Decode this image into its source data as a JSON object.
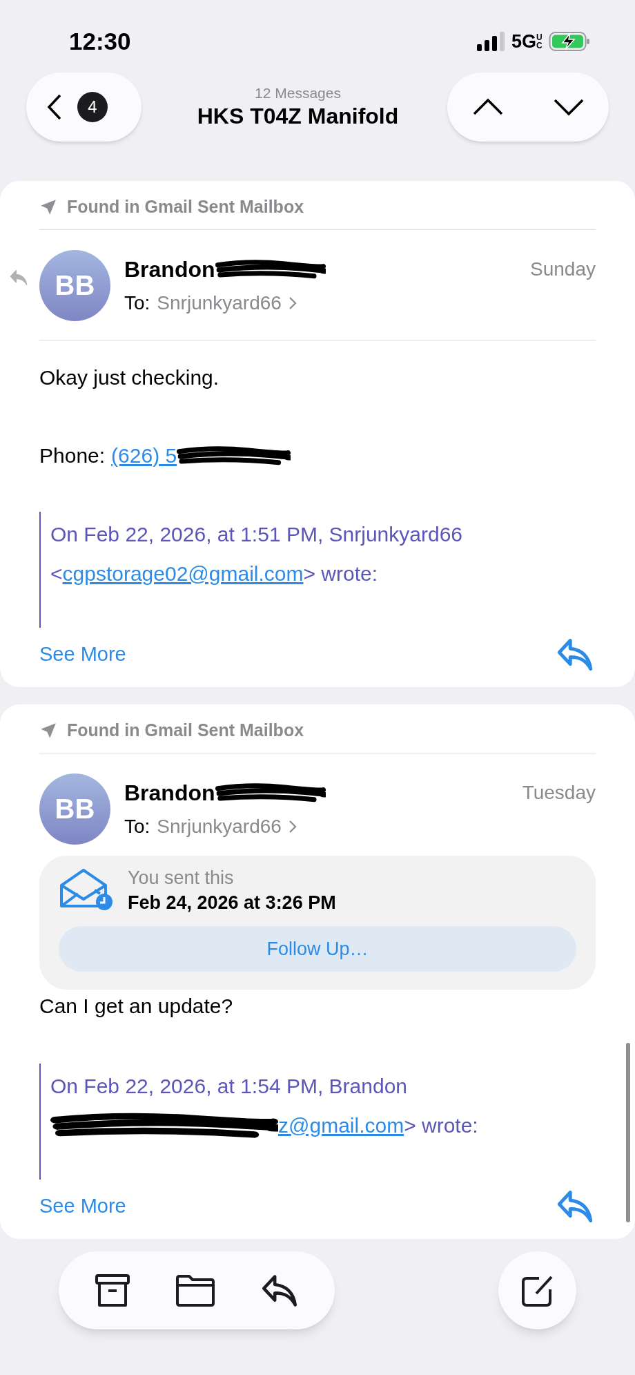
{
  "status_bar": {
    "time": "12:30",
    "network": "5G",
    "network_suffix": "UC",
    "charging": true
  },
  "nav": {
    "unread_count": "4",
    "message_count": "12 Messages",
    "subject": "HKS T04Z Manifold"
  },
  "messages": [
    {
      "mailbox_note": "Found in Gmail Sent Mailbox",
      "replied": true,
      "initials": "BB",
      "sender": "Brandon",
      "sender_redacted": true,
      "date": "Sunday",
      "to_label": "To:",
      "recipient": "Snrjunkyard66",
      "body": [
        {
          "kind": "text",
          "text": "Okay just checking."
        },
        {
          "kind": "phone",
          "label": "Phone:",
          "link": "(626) 5",
          "redacted": true
        }
      ],
      "quote": {
        "text": "On Feb 22, 2026, at 1:51 PM, Snrjunkyard66",
        "open": "<",
        "email": "cgpstorage02@gmail.com",
        "close": "> wrote:",
        "redacted": false
      },
      "see_more": "See More"
    },
    {
      "mailbox_note": "Found in Gmail Sent Mailbox",
      "replied": false,
      "initials": "BB",
      "sender": "Brandon",
      "sender_redacted": true,
      "date": "Tuesday",
      "to_label": "To:",
      "recipient": "Snrjunkyard66",
      "sent_banner": {
        "label": "You sent this",
        "time": "Feb 24, 2026 at 3:26 PM",
        "button": "Follow Up…"
      },
      "body": [
        {
          "kind": "text",
          "text": "Can I get an update?"
        }
      ],
      "quote": {
        "text": "On Feb 22, 2026, at 1:54 PM, Brandon",
        "email": "z@gmail.com",
        "close": "> wrote:",
        "redacted": true
      },
      "see_more": "See More"
    }
  ]
}
